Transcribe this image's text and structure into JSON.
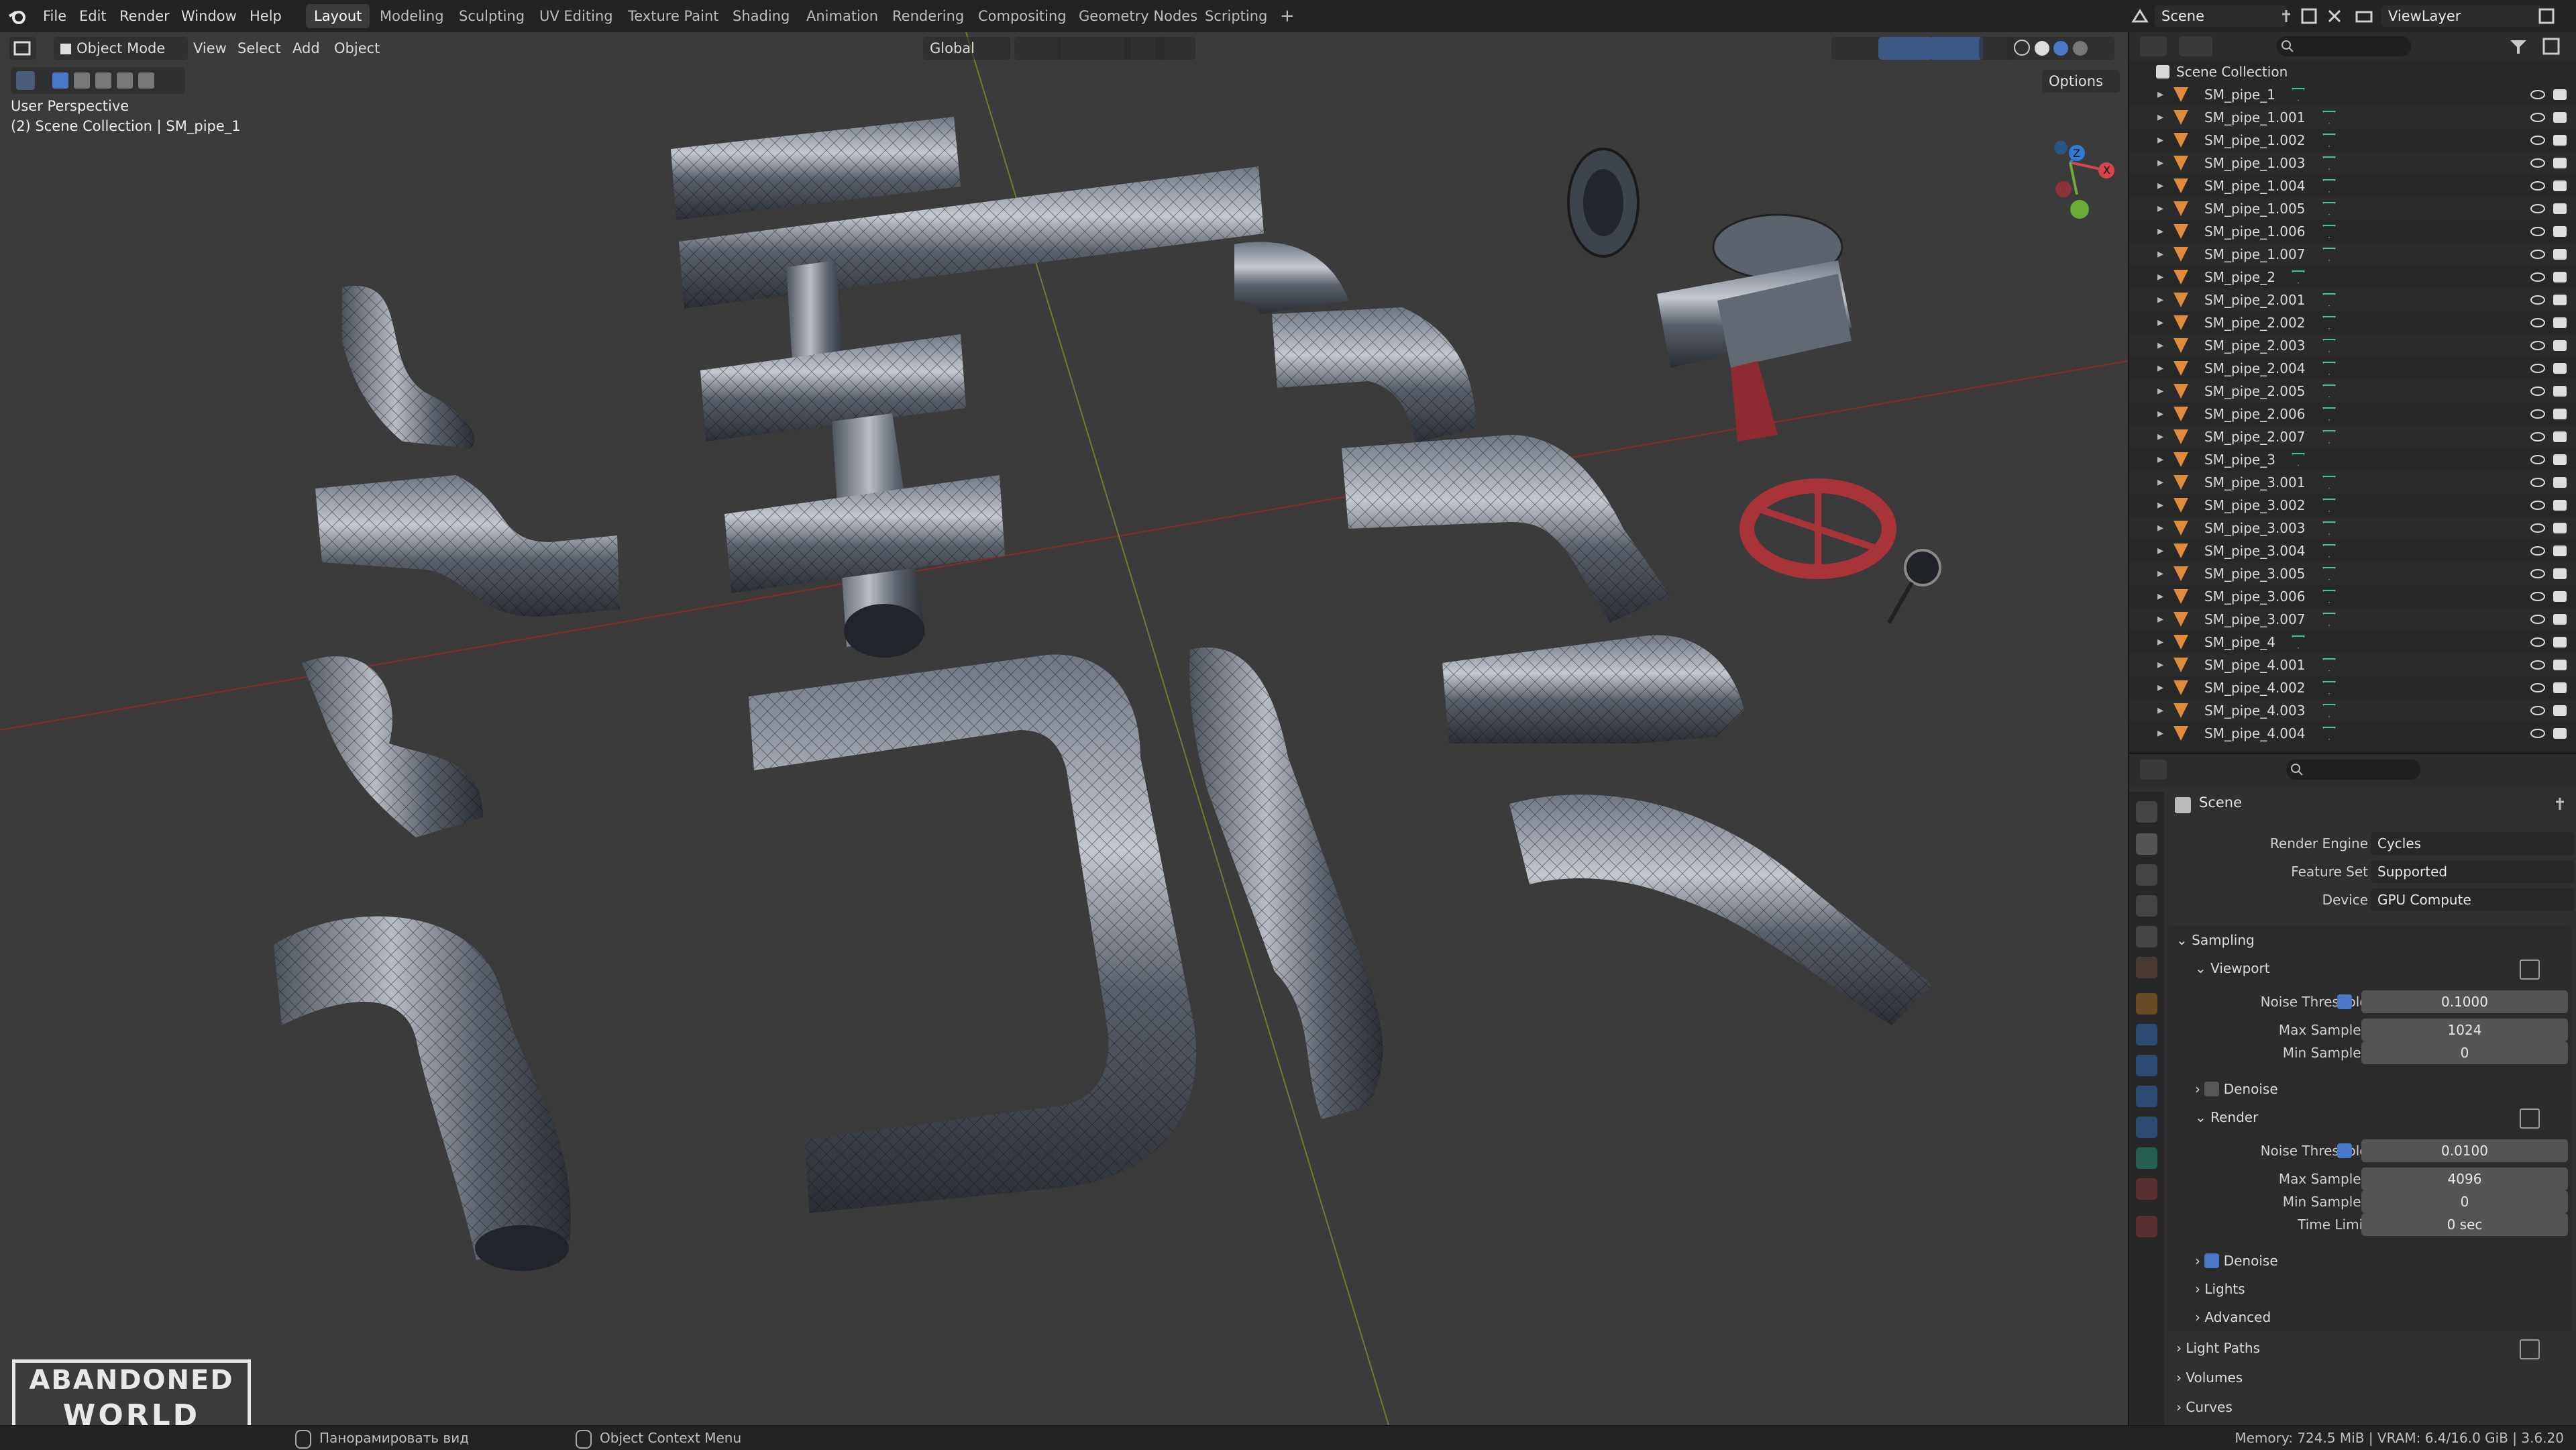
{
  "menu": [
    "File",
    "Edit",
    "Render",
    "Window",
    "Help"
  ],
  "workspaces": [
    {
      "label": "Layout",
      "active": true
    },
    {
      "label": "Modeling"
    },
    {
      "label": "Sculpting"
    },
    {
      "label": "UV Editing"
    },
    {
      "label": "Texture Paint"
    },
    {
      "label": "Shading"
    },
    {
      "label": "Animation"
    },
    {
      "label": "Rendering"
    },
    {
      "label": "Compositing"
    },
    {
      "label": "Geometry Nodes"
    },
    {
      "label": "Scripting"
    }
  ],
  "add_workspace": "+",
  "scene_name": "Scene",
  "view_layer": "ViewLayer",
  "viewport": {
    "mode": "Object Mode",
    "menus": [
      "View",
      "Select",
      "Add",
      "Object"
    ],
    "transform_orientation": "Global",
    "options_label": "Options",
    "perspective_label": "User Perspective",
    "collection_label": "(2) Scene Collection | SM_pipe_1",
    "gizmo": {
      "x": "X",
      "y": "Y",
      "z": "Z"
    },
    "watermark_line1": "ABANDONED",
    "watermark_line2": "WORLD"
  },
  "outliner": {
    "root": "Scene Collection",
    "items": [
      "SM_pipe_1",
      "SM_pipe_1.001",
      "SM_pipe_1.002",
      "SM_pipe_1.003",
      "SM_pipe_1.004",
      "SM_pipe_1.005",
      "SM_pipe_1.006",
      "SM_pipe_1.007",
      "SM_pipe_2",
      "SM_pipe_2.001",
      "SM_pipe_2.002",
      "SM_pipe_2.003",
      "SM_pipe_2.004",
      "SM_pipe_2.005",
      "SM_pipe_2.006",
      "SM_pipe_2.007",
      "SM_pipe_3",
      "SM_pipe_3.001",
      "SM_pipe_3.002",
      "SM_pipe_3.003",
      "SM_pipe_3.004",
      "SM_pipe_3.005",
      "SM_pipe_3.006",
      "SM_pipe_3.007",
      "SM_pipe_4",
      "SM_pipe_4.001",
      "SM_pipe_4.002",
      "SM_pipe_4.003",
      "SM_pipe_4.004"
    ]
  },
  "properties": {
    "context": "Scene",
    "render_engine_label": "Render Engine",
    "render_engine": "Cycles",
    "feature_set_label": "Feature Set",
    "feature_set": "Supported",
    "device_label": "Device",
    "device": "GPU Compute",
    "sampling": "Sampling",
    "viewport_panel": "Viewport",
    "render_panel": "Render",
    "noise_threshold_label": "Noise Threshold",
    "max_samples_label": "Max Samples",
    "min_samples_label": "Min Samples",
    "time_limit_label": "Time Limit",
    "denoise_label": "Denoise",
    "viewport_noise_threshold": "0.1000",
    "viewport_max_samples": "1024",
    "viewport_min_samples": "0",
    "render_noise_threshold": "0.0100",
    "render_max_samples": "4096",
    "render_min_samples": "0",
    "render_time_limit": "0 sec",
    "lights": "Lights",
    "advanced": "Advanced",
    "light_paths": "Light Paths",
    "volumes": "Volumes",
    "curves": "Curves"
  },
  "status": {
    "pan_hint": "Панорамировать вид",
    "context_hint": "Object Context Menu",
    "stats": "Memory: 724.5 MiB | VRAM: 6.4/16.0 GiB | 3.6.20"
  },
  "colors": {
    "accent": "#4a78c8",
    "mesh_icon": "#e08a3c",
    "data_icon": "#3cc2a0",
    "pipe_red": "#a8343a"
  }
}
